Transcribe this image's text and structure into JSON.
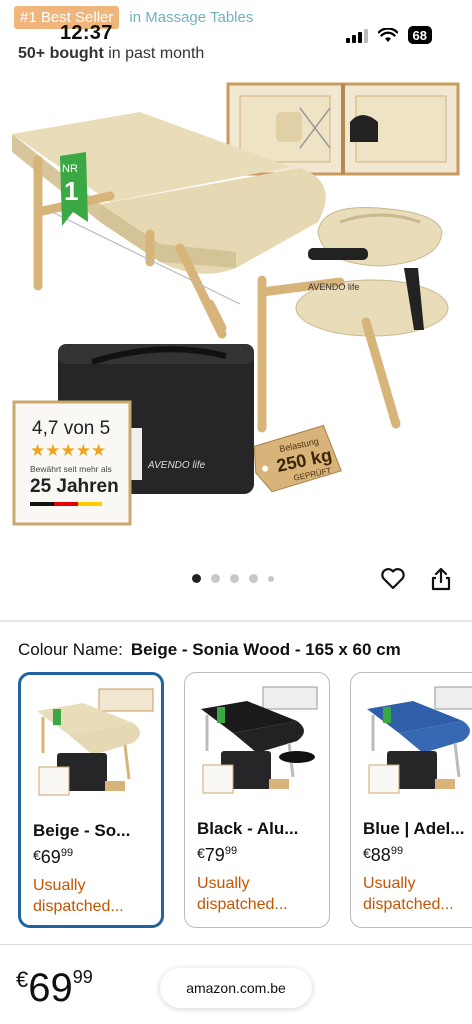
{
  "status_bar": {
    "time": "12:37",
    "battery": "68"
  },
  "header": {
    "badge": "#1 Best Seller",
    "category": "in Massage Tables",
    "bought_bold": "50+ bought",
    "bought_rest": " in past month"
  },
  "hero": {
    "rating_text": "4,7 von 5",
    "years_small": "Bewährt seit mehr als",
    "years_big": "25 Jahren",
    "tag_line1": "Belastung",
    "tag_line2": "250 kg",
    "tag_line3": "GEPRÜFT",
    "brand": "AVENDO life",
    "nr_label": "NR",
    "nr_value": "1"
  },
  "carousel": {
    "total": 5,
    "active": 1
  },
  "colour": {
    "label": "Colour Name:",
    "value": "Beige - Sonia Wood - 165 x 60 cm"
  },
  "variants": [
    {
      "name": "Beige - So...",
      "currency": "€",
      "whole": "69",
      "fraction": "99",
      "status": "Usually dispatched...",
      "color": "#e9ddc0",
      "selected": true
    },
    {
      "name": "Black - Alu...",
      "currency": "€",
      "whole": "79",
      "fraction": "99",
      "status": "Usually dispatched...",
      "color": "#1a1a1a",
      "selected": false
    },
    {
      "name": "Blue | Adel...",
      "currency": "€",
      "whole": "88",
      "fraction": "99",
      "status": "Usually dispatched...",
      "color": "#2e5fa8",
      "selected": false
    }
  ],
  "bottom": {
    "currency": "€",
    "whole": "69",
    "fraction": "99",
    "url": "amazon.com.be"
  },
  "colors": {
    "accent": "#2162a1",
    "status": "#c45500",
    "badge": "#e47911",
    "link": "#007185"
  }
}
